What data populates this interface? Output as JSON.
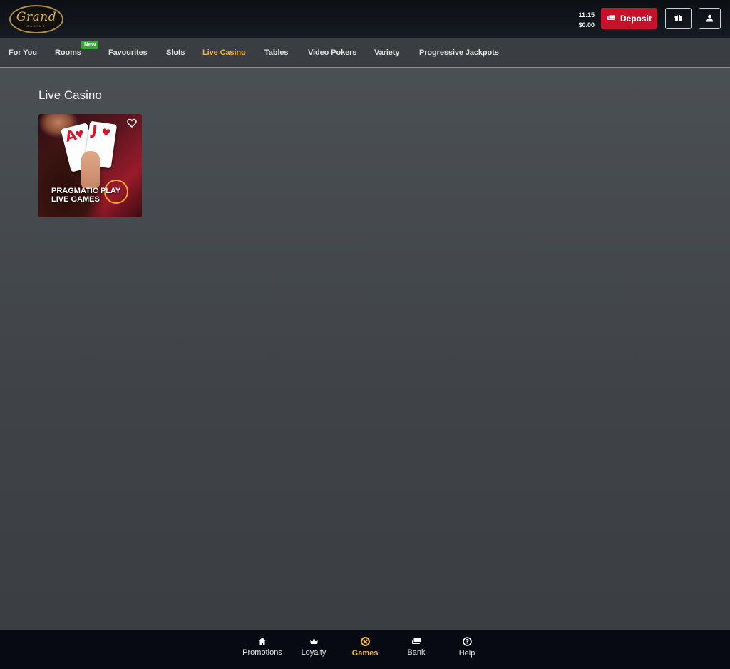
{
  "header": {
    "logo_text": "Grand",
    "logo_sub": "CASINO",
    "time": "11:15",
    "balance": "$0.00",
    "deposit_label": "Deposit",
    "gift_icon": "gift-icon",
    "account_icon": "user-icon"
  },
  "nav": {
    "items": [
      {
        "label": "For You",
        "active": false
      },
      {
        "label": "Rooms",
        "active": false
      },
      {
        "label": "Favourites",
        "active": false
      },
      {
        "label": "Slots",
        "active": false
      },
      {
        "label": "Live Casino",
        "active": true
      },
      {
        "label": "Tables",
        "active": false
      },
      {
        "label": "Video Pokers",
        "active": false
      },
      {
        "label": "Variety",
        "active": false
      },
      {
        "label": "Progressive Jackpots",
        "active": false
      }
    ],
    "new_badge": "New"
  },
  "main": {
    "section_title": "Live Casino",
    "games": [
      {
        "brand_line1": "PRAGMATIC",
        "brand_play": "PLAY",
        "brand_line2": "LIVE GAMES",
        "favourite_icon": "heart-icon"
      }
    ]
  },
  "bottom_nav": {
    "items": [
      {
        "label": "Promotions",
        "icon": "home-icon",
        "active": false
      },
      {
        "label": "Loyalty",
        "icon": "crown-icon",
        "active": false
      },
      {
        "label": "Games",
        "icon": "chip-icon",
        "active": true
      },
      {
        "label": "Bank",
        "icon": "money-icon",
        "active": false
      },
      {
        "label": "Help",
        "icon": "help-icon",
        "active": false
      }
    ]
  },
  "colors": {
    "accent": "#f2b649",
    "deposit": "#c4122a",
    "new_badge": "#3aa63a",
    "header_bg": "#0c0f14",
    "bottom_bg": "#070a12"
  }
}
